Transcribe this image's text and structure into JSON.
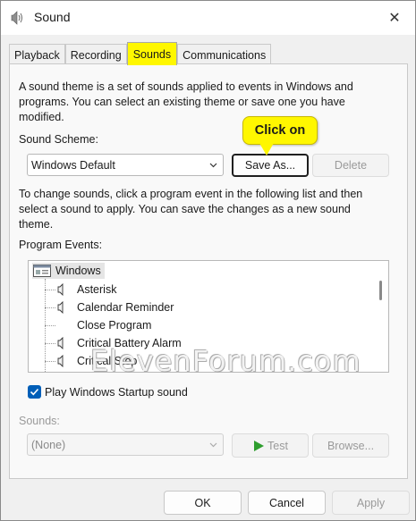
{
  "window": {
    "title": "Sound",
    "app_icon": "speaker-icon",
    "close_icon": "close-icon",
    "close_glyph": "✕"
  },
  "tabs": [
    {
      "label": "Playback",
      "active": false
    },
    {
      "label": "Recording",
      "active": false
    },
    {
      "label": "Sounds",
      "active": true
    },
    {
      "label": "Communications",
      "active": false
    }
  ],
  "sounds_tab": {
    "description": "A sound theme is a set of sounds applied to events in Windows and programs.  You can select an existing theme or save one you have modified.",
    "scheme_label": "Sound Scheme:",
    "scheme_value": "Windows Default",
    "save_as_label": "Save As...",
    "delete_label": "Delete",
    "callout": "Click on",
    "instructions": "To change sounds, click a program event in the following list and then select a sound to apply.  You can save the changes as a new sound theme.",
    "program_events_label": "Program Events:",
    "events_root": "Windows",
    "events": [
      {
        "label": "Asterisk",
        "has_sound": true
      },
      {
        "label": "Calendar Reminder",
        "has_sound": true
      },
      {
        "label": "Close Program",
        "has_sound": false
      },
      {
        "label": "Critical Battery Alarm",
        "has_sound": true
      },
      {
        "label": "Critical Stop",
        "has_sound": true
      }
    ],
    "startup_checkbox_label": "Play Windows Startup sound",
    "startup_checked": true,
    "sounds_label": "Sounds:",
    "sounds_value": "(None)",
    "test_label": "Test",
    "browse_label": "Browse..."
  },
  "footer": {
    "ok_label": "OK",
    "cancel_label": "Cancel",
    "apply_label": "Apply"
  },
  "watermark": "ElevenForum.com",
  "colors": {
    "highlight": "#fff700",
    "checkbox": "#005fb8",
    "play_triangle": "#2e9e2e"
  }
}
